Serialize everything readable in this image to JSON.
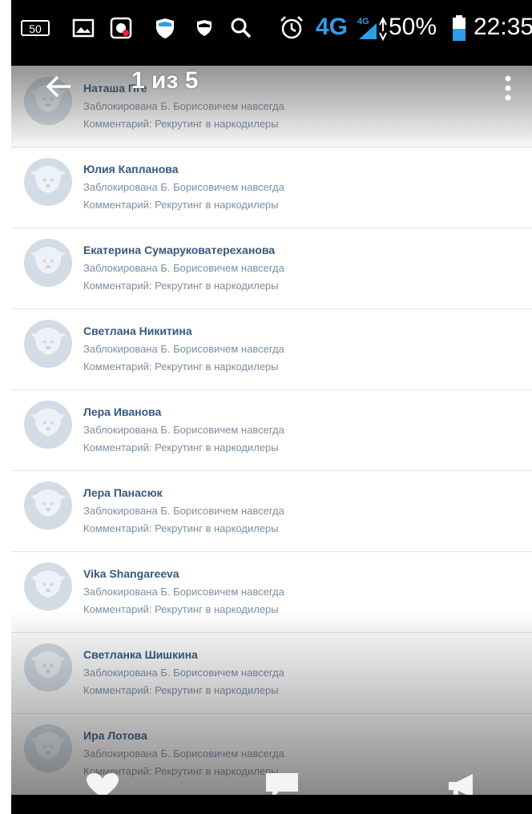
{
  "status_bar": {
    "notification_count": "50",
    "network": "4G",
    "network_small": "4G",
    "battery": "50%",
    "time": "22:35",
    "icons": [
      "notification-badge-icon",
      "image-icon",
      "app-icon",
      "shield-icon",
      "shield-small-icon",
      "search-icon",
      "alarm-icon",
      "signal-icon",
      "battery-icon"
    ]
  },
  "toolbar": {
    "title": "1 из 5",
    "back_icon": "arrow-left-icon",
    "more_icon": "more-vertical-icon"
  },
  "list": {
    "items": [
      {
        "name": "Наташа Пге",
        "status": "Заблокирована Б. Борисовичем навсегда",
        "comment": "Комментарий: Рекрутинг в наркодилеры"
      },
      {
        "name": "Юлия Капланова",
        "status": "Заблокирована Б. Борисовичем навсегда",
        "comment": "Комментарий: Рекрутинг в наркодилеры"
      },
      {
        "name": "Екатерина Сумаруковатереханова",
        "status": "Заблокирована Б. Борисовичем навсегда",
        "comment": "Комментарий: Рекрутинг в наркодилеры"
      },
      {
        "name": "Светлана Никитина",
        "status": "Заблокирована Б. Борисовичем навсегда",
        "comment": "Комментарий: Рекрутинг в наркодилеры"
      },
      {
        "name": "Лера Иванова",
        "status": "Заблокирована Б. Борисовичем навсегда",
        "comment": "Комментарий: Рекрутинг в наркодилеры"
      },
      {
        "name": "Лера Панасюк",
        "status": "Заблокирована Б. Борисовичем навсегда",
        "comment": "Комментарий: Рекрутинг в наркодилеры"
      },
      {
        "name": "Vika Shangareeva",
        "status": "Заблокирована Б. Борисовичем навсегда",
        "comment": "Комментарий: Рекрутинг в наркодилеры"
      },
      {
        "name": "Светланка Шишкина",
        "status": "Заблокирована Б. Борисовичем навсегда",
        "comment": "Комментарий: Рекрутинг в наркодилеры"
      },
      {
        "name": "Ира Лотова",
        "status": "Заблокирована Б. Борисовичем навсегда",
        "comment": "Комментарий: Рекрутинг в наркодилеры"
      }
    ]
  },
  "bottom_actions": {
    "icons": [
      "heart-icon",
      "comment-icon",
      "share-icon"
    ]
  },
  "colors": {
    "name": "#35597f",
    "meta": "#7c8fa3",
    "avatar_bg": "#d2dce6",
    "network_accent": "#2f9de8",
    "battery_accent": "#2f9de8"
  }
}
